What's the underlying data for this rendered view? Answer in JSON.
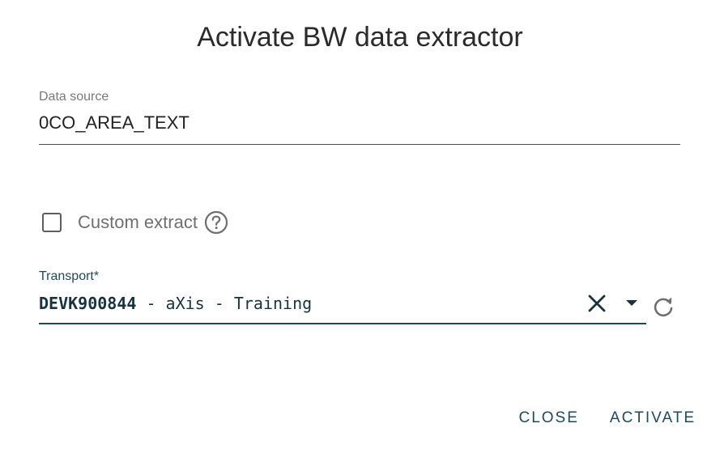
{
  "dialog": {
    "title": "Activate BW data extractor"
  },
  "data_source": {
    "label": "Data source",
    "value": "0CO_AREA_TEXT"
  },
  "custom_extract": {
    "label": "Custom extract",
    "checked": false,
    "help_icon": "help-circle-icon"
  },
  "transport": {
    "label": "Transport*",
    "code": "DEVK900844",
    "description": " - aXis - Training",
    "clear_icon": "close-icon",
    "dropdown_icon": "caret-down-icon",
    "refresh_icon": "refresh-icon"
  },
  "actions": {
    "close_label": "CLOSE",
    "activate_label": "ACTIVATE"
  },
  "colors": {
    "accent": "#1f4a5c",
    "text": "#222222",
    "muted": "#7a7a7a"
  }
}
